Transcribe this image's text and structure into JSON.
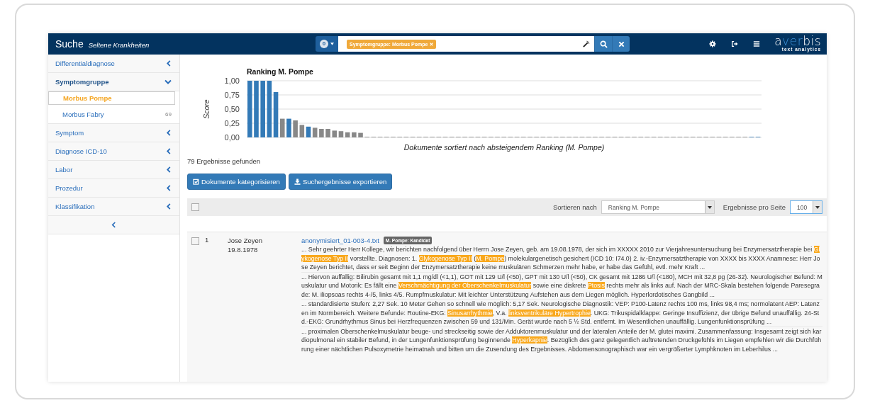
{
  "header": {
    "title": "Suche",
    "subtitle": "Seltene Krankheiten",
    "badge": "0",
    "search_tags": [
      {
        "label": "Symptomgruppe: Morbus Pompe"
      }
    ],
    "logo": {
      "parts": [
        {
          "text": "a",
          "accent": false
        },
        {
          "text": "ver",
          "accent": true
        },
        {
          "text": "bis",
          "accent": false
        }
      ],
      "tagline": "text analytics"
    }
  },
  "sidebar": {
    "items": [
      {
        "label": "Differentialdiagnose",
        "expanded": false
      },
      {
        "label": "Symptomgruppe",
        "expanded": true,
        "children": [
          {
            "label": "Morbus Pompe",
            "selected": true
          },
          {
            "label": "Morbus Fabry",
            "count": "69",
            "selected": false
          }
        ]
      },
      {
        "label": "Symptom",
        "expanded": false
      },
      {
        "label": "Diagnose ICD-10",
        "expanded": false
      },
      {
        "label": "Labor",
        "expanded": false
      },
      {
        "label": "Prozedur",
        "expanded": false
      },
      {
        "label": "Klassifikation",
        "expanded": false
      }
    ]
  },
  "chart_data": {
    "type": "bar",
    "title": "Ranking M. Pompe",
    "xlabel": "Dokumente sortiert nach absteigendem Ranking (M. Pompe)",
    "ylabel": "Score",
    "stacked": true,
    "grid": true,
    "ylim": [
      0,
      1
    ],
    "yticks": [
      {
        "value": 0,
        "label": "0,00"
      },
      {
        "value": 0.25,
        "label": "0,25"
      },
      {
        "value": 0.5,
        "label": "0,50"
      },
      {
        "value": 0.75,
        "label": "0,75"
      },
      {
        "value": 1,
        "label": "1,00"
      }
    ],
    "series": [
      {
        "color": "#337ab7",
        "values": [
          1,
          1,
          1,
          1,
          0.8,
          null,
          0.33,
          null,
          null,
          0.19,
          null,
          null,
          null,
          null,
          null,
          null,
          null,
          null,
          null,
          null,
          null,
          null,
          null,
          null,
          null,
          null,
          null,
          null,
          null,
          null,
          null,
          null,
          null,
          null,
          null,
          null,
          null,
          null,
          null,
          null,
          null,
          null,
          null,
          null,
          null,
          null,
          null,
          null,
          null,
          null,
          null,
          null,
          null,
          null,
          null,
          null,
          null,
          null,
          null,
          null,
          null,
          null,
          null,
          null,
          null,
          null,
          null,
          null,
          null,
          null,
          null,
          null,
          null,
          null,
          null,
          null,
          null,
          0.01,
          0.01
        ]
      },
      {
        "color": "#888888",
        "values": [
          null,
          null,
          null,
          null,
          null,
          0.33,
          null,
          0.3,
          0.22,
          null,
          0.17,
          0.15,
          0.15,
          0.12,
          0.11,
          0.09,
          0.09,
          0.08,
          0.01,
          0.01,
          0.01,
          0.01,
          0.01,
          0.01,
          0.01,
          0.01,
          0.01,
          0.01,
          0.01,
          0.01,
          0.01,
          0.01,
          0.01,
          0.01,
          0.01,
          0.01,
          0.01,
          0.01,
          0.01,
          0.01,
          0.01,
          0.01,
          0.01,
          0.01,
          0.01,
          0.01,
          0.01,
          0.01,
          0.01,
          0.01,
          0.01,
          0.01,
          0.01,
          0.01,
          0.01,
          0.01,
          0.01,
          0.01,
          0.01,
          0.01,
          0.01,
          0.01,
          0.01,
          0.01,
          0.01,
          0.01,
          0.01,
          0.01,
          0.01,
          0.01,
          0.01,
          0.01,
          0.01,
          0.01,
          0.01,
          0.01,
          0.01,
          null,
          null
        ]
      }
    ]
  },
  "result_count": "79 Ergebnisse gefunden",
  "buttons": [
    {
      "label": "Dokumente kategorisieren",
      "kind": "categorize"
    },
    {
      "label": "Suchergebnisse exportieren",
      "kind": "export"
    }
  ],
  "toolbar": {
    "select_all_checked": false,
    "sort_label": "Sortieren nach",
    "sort_value": "Ranking M. Pompe",
    "per_page_label": "Ergebnisse pro Seite",
    "per_page_value": "100"
  },
  "results": [
    {
      "checked": false,
      "rank": "1",
      "name": "Jose Zeyen",
      "date": "19.8.1978",
      "file": "anonymisiert_01-003-4.txt",
      "tag": "M. Pompe: Kandidat",
      "snippets": [
        [
          {
            "text": "...  Sehr geehrter Herr Kollege, wir berichten nachfolgend über Herrn Jose Zeyen, geb. am 19.08.1978, der sich im XXXXX 2010 zur Vierjahresuntersuchung bei Enzymersatztherapie bei ",
            "highlight": false
          },
          {
            "text": "Glykogenose Typ II",
            "highlight": true
          },
          {
            "text": " vorstellte. Diagnosen: 1. ",
            "highlight": false
          },
          {
            "text": "Glykogenose Typ II",
            "highlight": true
          },
          {
            "text": " (",
            "highlight": false
          },
          {
            "text": "M. Pompe",
            "highlight": true
          },
          {
            "text": ") molekulargenetisch gesichert (ICD 10: I74.0) 2. iv.-Enzymersatztherapie von XXXX bis XXXX Anamnese: Herr Jose Zeyen berichtet, dass er seit Beginn der Enzymersatztherapie keine muskulären Schmerzen mehr habe, er habe das Gefühl, evtl. mehr Kraft ...",
            "highlight": false
          }
        ],
        [
          {
            "text": "... Hiervon auffällig: Bilirubin gesamt mit 1,1 mg/dl (<1,1), GOT mit 129 U/l (<50), GPT mit 130 U/l (<50), CK gesamt mit 1286 U/l (<180), MCH mit 32,8 pg (26-32). Neurologischer Befund: Muskulatur und Motorik: Es fällt eine ",
            "highlight": false
          },
          {
            "text": "Verschmächtigung der Oberschenkelmuskulatur",
            "highlight": true
          },
          {
            "text": " sowie eine diskrete ",
            "highlight": false
          },
          {
            "text": "Ptosis",
            "highlight": true
          },
          {
            "text": " rechts mehr als links auf. Nach der MRC-Skala bestehen folgende Paresegrade: M. iliopsoas rechts 4-/5, links 4/5. Rumpfmuskulatur: Mit leichter Unterstützung Aufstehen aus dem Liegen möglich. Hyperlordotisches Gangbild ...",
            "highlight": false
          }
        ],
        [
          {
            "text": "... standardisierte Stufen: 2,27 Sek. 10 Meter Gehen so schnell wie möglich: 5,17 Sek. Neurologische Diagnostik: VEP: P100-Latenz rechts 100 ms, links 98,4 ms; normolatent AEP: Latenzen im Normbereich. Weitere Befunde: Routine-EKG: ",
            "highlight": false
          },
          {
            "text": "Sinusarrhythmie",
            "highlight": true
          },
          {
            "text": ", V.a. ",
            "highlight": false
          },
          {
            "text": "linksventrikuläre Hypertrophie",
            "highlight": true
          },
          {
            "text": ". UKG: Trikuspidalklappe: Geringe Insuffizienz, der übrige Befund unauffällig. 24-Std.-EKG: Grundrhythmus Sinus bei Herzfrequenzen zwischen 59 und 131/Min. Gerät wurde nach 5 ½ Std. entfernt. Im Wesentlichen unauffällig. Lungenfunktionsprüfung ...",
            "highlight": false
          }
        ],
        [
          {
            "text": "... proximalen Oberschenkelmuskulatur beuge- und streckseitig sowie der Adduktorenmuskulatur und der lateralen Anteile der M. glutei maximi. Zusammenfassung: Insgesamt zeigt sich kardiopulmonal ein stabiler Befund, in der Lungenfunktionsprüfung beginnende ",
            "highlight": false
          },
          {
            "text": "Hyperkapnie",
            "highlight": true
          },
          {
            "text": ". Bezüglich des ganz gelegentlich auftretenden Druckgefühls im Liegen empfehlen wir die Durchführung einer nächtlichen Pulsoxymetrie heimatnah und bitten um die Zusendung des Ergebnisses. Abdomensonographisch war ein vergrößerter Lymphknoten im Leberhilus ...",
            "highlight": false
          }
        ]
      ]
    }
  ]
}
